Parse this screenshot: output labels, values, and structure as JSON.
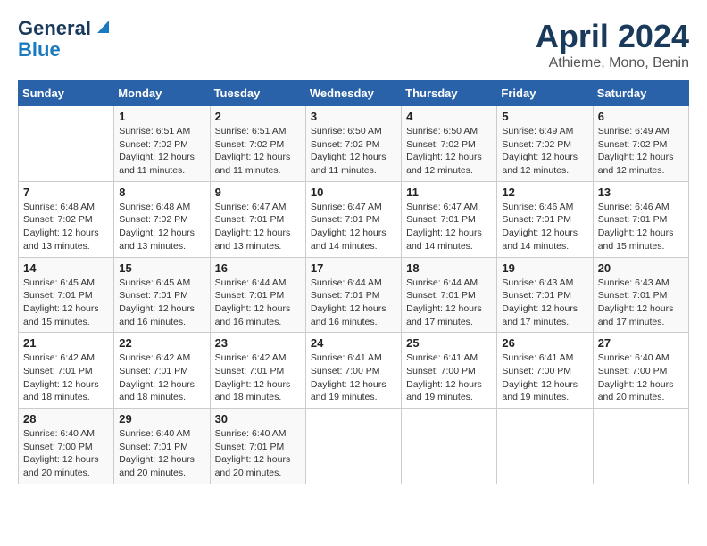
{
  "logo": {
    "line1": "General",
    "line2": "Blue"
  },
  "title": "April 2024",
  "location": "Athieme, Mono, Benin",
  "days_of_week": [
    "Sunday",
    "Monday",
    "Tuesday",
    "Wednesday",
    "Thursday",
    "Friday",
    "Saturday"
  ],
  "weeks": [
    [
      {
        "num": "",
        "sunrise": "",
        "sunset": "",
        "daylight": ""
      },
      {
        "num": "1",
        "sunrise": "Sunrise: 6:51 AM",
        "sunset": "Sunset: 7:02 PM",
        "daylight": "Daylight: 12 hours and 11 minutes."
      },
      {
        "num": "2",
        "sunrise": "Sunrise: 6:51 AM",
        "sunset": "Sunset: 7:02 PM",
        "daylight": "Daylight: 12 hours and 11 minutes."
      },
      {
        "num": "3",
        "sunrise": "Sunrise: 6:50 AM",
        "sunset": "Sunset: 7:02 PM",
        "daylight": "Daylight: 12 hours and 11 minutes."
      },
      {
        "num": "4",
        "sunrise": "Sunrise: 6:50 AM",
        "sunset": "Sunset: 7:02 PM",
        "daylight": "Daylight: 12 hours and 12 minutes."
      },
      {
        "num": "5",
        "sunrise": "Sunrise: 6:49 AM",
        "sunset": "Sunset: 7:02 PM",
        "daylight": "Daylight: 12 hours and 12 minutes."
      },
      {
        "num": "6",
        "sunrise": "Sunrise: 6:49 AM",
        "sunset": "Sunset: 7:02 PM",
        "daylight": "Daylight: 12 hours and 12 minutes."
      }
    ],
    [
      {
        "num": "7",
        "sunrise": "Sunrise: 6:48 AM",
        "sunset": "Sunset: 7:02 PM",
        "daylight": "Daylight: 12 hours and 13 minutes."
      },
      {
        "num": "8",
        "sunrise": "Sunrise: 6:48 AM",
        "sunset": "Sunset: 7:02 PM",
        "daylight": "Daylight: 12 hours and 13 minutes."
      },
      {
        "num": "9",
        "sunrise": "Sunrise: 6:47 AM",
        "sunset": "Sunset: 7:01 PM",
        "daylight": "Daylight: 12 hours and 13 minutes."
      },
      {
        "num": "10",
        "sunrise": "Sunrise: 6:47 AM",
        "sunset": "Sunset: 7:01 PM",
        "daylight": "Daylight: 12 hours and 14 minutes."
      },
      {
        "num": "11",
        "sunrise": "Sunrise: 6:47 AM",
        "sunset": "Sunset: 7:01 PM",
        "daylight": "Daylight: 12 hours and 14 minutes."
      },
      {
        "num": "12",
        "sunrise": "Sunrise: 6:46 AM",
        "sunset": "Sunset: 7:01 PM",
        "daylight": "Daylight: 12 hours and 14 minutes."
      },
      {
        "num": "13",
        "sunrise": "Sunrise: 6:46 AM",
        "sunset": "Sunset: 7:01 PM",
        "daylight": "Daylight: 12 hours and 15 minutes."
      }
    ],
    [
      {
        "num": "14",
        "sunrise": "Sunrise: 6:45 AM",
        "sunset": "Sunset: 7:01 PM",
        "daylight": "Daylight: 12 hours and 15 minutes."
      },
      {
        "num": "15",
        "sunrise": "Sunrise: 6:45 AM",
        "sunset": "Sunset: 7:01 PM",
        "daylight": "Daylight: 12 hours and 16 minutes."
      },
      {
        "num": "16",
        "sunrise": "Sunrise: 6:44 AM",
        "sunset": "Sunset: 7:01 PM",
        "daylight": "Daylight: 12 hours and 16 minutes."
      },
      {
        "num": "17",
        "sunrise": "Sunrise: 6:44 AM",
        "sunset": "Sunset: 7:01 PM",
        "daylight": "Daylight: 12 hours and 16 minutes."
      },
      {
        "num": "18",
        "sunrise": "Sunrise: 6:44 AM",
        "sunset": "Sunset: 7:01 PM",
        "daylight": "Daylight: 12 hours and 17 minutes."
      },
      {
        "num": "19",
        "sunrise": "Sunrise: 6:43 AM",
        "sunset": "Sunset: 7:01 PM",
        "daylight": "Daylight: 12 hours and 17 minutes."
      },
      {
        "num": "20",
        "sunrise": "Sunrise: 6:43 AM",
        "sunset": "Sunset: 7:01 PM",
        "daylight": "Daylight: 12 hours and 17 minutes."
      }
    ],
    [
      {
        "num": "21",
        "sunrise": "Sunrise: 6:42 AM",
        "sunset": "Sunset: 7:01 PM",
        "daylight": "Daylight: 12 hours and 18 minutes."
      },
      {
        "num": "22",
        "sunrise": "Sunrise: 6:42 AM",
        "sunset": "Sunset: 7:01 PM",
        "daylight": "Daylight: 12 hours and 18 minutes."
      },
      {
        "num": "23",
        "sunrise": "Sunrise: 6:42 AM",
        "sunset": "Sunset: 7:01 PM",
        "daylight": "Daylight: 12 hours and 18 minutes."
      },
      {
        "num": "24",
        "sunrise": "Sunrise: 6:41 AM",
        "sunset": "Sunset: 7:00 PM",
        "daylight": "Daylight: 12 hours and 19 minutes."
      },
      {
        "num": "25",
        "sunrise": "Sunrise: 6:41 AM",
        "sunset": "Sunset: 7:00 PM",
        "daylight": "Daylight: 12 hours and 19 minutes."
      },
      {
        "num": "26",
        "sunrise": "Sunrise: 6:41 AM",
        "sunset": "Sunset: 7:00 PM",
        "daylight": "Daylight: 12 hours and 19 minutes."
      },
      {
        "num": "27",
        "sunrise": "Sunrise: 6:40 AM",
        "sunset": "Sunset: 7:00 PM",
        "daylight": "Daylight: 12 hours and 20 minutes."
      }
    ],
    [
      {
        "num": "28",
        "sunrise": "Sunrise: 6:40 AM",
        "sunset": "Sunset: 7:00 PM",
        "daylight": "Daylight: 12 hours and 20 minutes."
      },
      {
        "num": "29",
        "sunrise": "Sunrise: 6:40 AM",
        "sunset": "Sunset: 7:01 PM",
        "daylight": "Daylight: 12 hours and 20 minutes."
      },
      {
        "num": "30",
        "sunrise": "Sunrise: 6:40 AM",
        "sunset": "Sunset: 7:01 PM",
        "daylight": "Daylight: 12 hours and 20 minutes."
      },
      {
        "num": "",
        "sunrise": "",
        "sunset": "",
        "daylight": ""
      },
      {
        "num": "",
        "sunrise": "",
        "sunset": "",
        "daylight": ""
      },
      {
        "num": "",
        "sunrise": "",
        "sunset": "",
        "daylight": ""
      },
      {
        "num": "",
        "sunrise": "",
        "sunset": "",
        "daylight": ""
      }
    ]
  ]
}
